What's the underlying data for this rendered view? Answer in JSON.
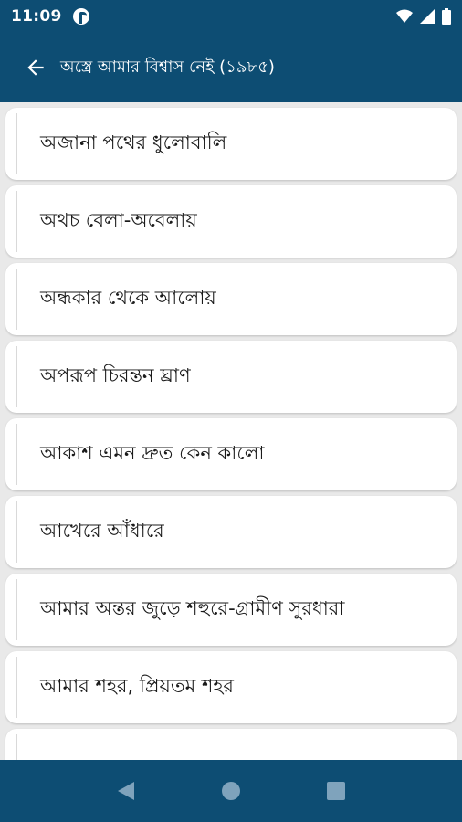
{
  "status_bar": {
    "time": "11:09",
    "app_icon": "pocket-p-icon",
    "right_icons": [
      "wifi-icon",
      "signal-icon",
      "battery-icon"
    ]
  },
  "app_bar": {
    "back_icon": "arrow-left-icon",
    "title": "অস্ত্রে আমার বিশ্বাস নেই (১৯৮৫)"
  },
  "list": {
    "items": [
      {
        "label": "অজানা পথের ধুলোবালি"
      },
      {
        "label": "অথচ বেলা-অবেলায়"
      },
      {
        "label": "অন্ধকার থেকে আলোয়"
      },
      {
        "label": "অপরূপ চিরন্তন ঘ্রাণ"
      },
      {
        "label": "আকাশ এমন দ্রুত কেন কালো"
      },
      {
        "label": "আখেরে আঁধারে"
      },
      {
        "label": "আমার অন্তর জুড়ে শহুরে-গ্রামীণ সুরধারা"
      },
      {
        "label": "আমার শহর, প্রিয়তম শহর"
      },
      {
        "label": ""
      }
    ]
  },
  "nav_bar": {
    "buttons": [
      "back-triangle-icon",
      "home-circle-icon",
      "recents-square-icon"
    ]
  },
  "colors": {
    "primary": "#0d4d73",
    "background": "#e9e9e9",
    "card": "#ffffff",
    "text": "#1a1a1a"
  }
}
